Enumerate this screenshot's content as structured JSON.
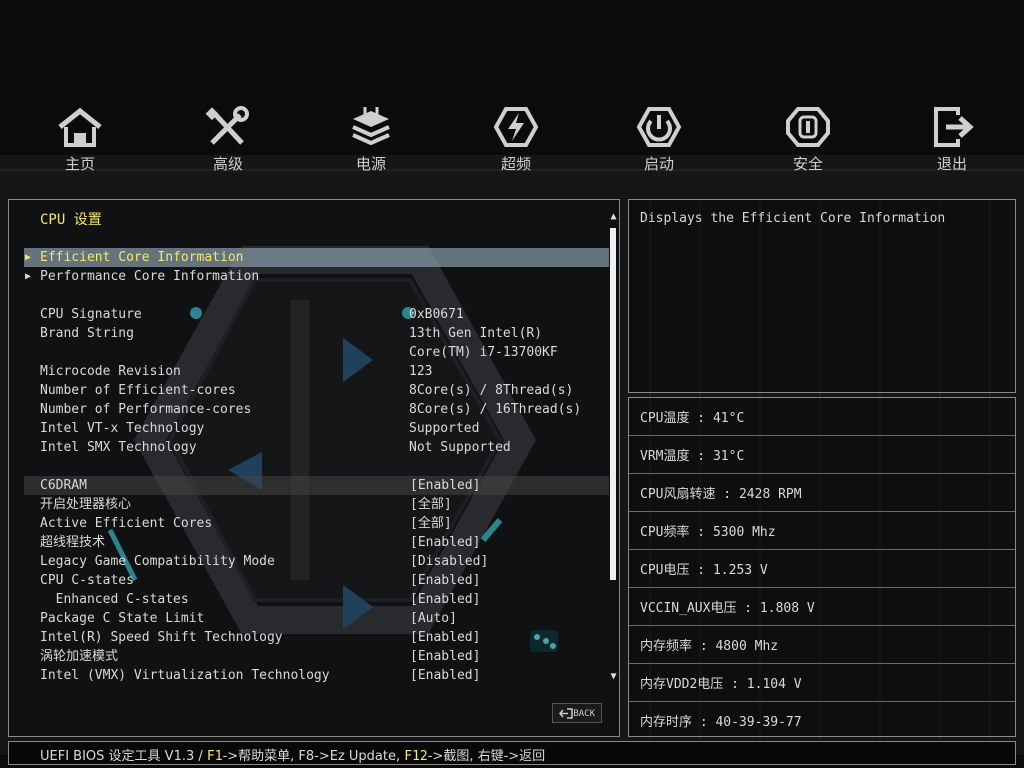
{
  "nav": [
    {
      "label": "主页",
      "icon": "home-icon"
    },
    {
      "label": "高级",
      "icon": "tools-icon"
    },
    {
      "label": "电源",
      "icon": "power-supply-icon"
    },
    {
      "label": "超频",
      "icon": "overclock-icon"
    },
    {
      "label": "启动",
      "icon": "boot-icon"
    },
    {
      "label": "安全",
      "icon": "security-icon"
    },
    {
      "label": "退出",
      "icon": "exit-icon"
    }
  ],
  "section_title": "CPU 设置",
  "submenus": [
    {
      "label": "Efficient Core Information",
      "highlighted": true
    },
    {
      "label": "Performance Core Information",
      "highlighted": false
    }
  ],
  "info": [
    {
      "label": "CPU Signature",
      "value": "0xB0671"
    },
    {
      "label": "Brand String",
      "value": "13th Gen Intel(R)"
    },
    {
      "label": "",
      "value": "Core(TM) i7-13700KF"
    },
    {
      "label": "Microcode Revision",
      "value": "123"
    },
    {
      "label": "Number of Efficient-cores",
      "value": "8Core(s) / 8Thread(s)"
    },
    {
      "label": "Number of Performance-cores",
      "value": "8Core(s) / 16Thread(s)"
    },
    {
      "label": "Intel VT-x Technology",
      "value": "Supported"
    },
    {
      "label": "Intel SMX Technology",
      "value": "Not Supported"
    }
  ],
  "options": [
    {
      "label": "C6DRAM",
      "value": "[Enabled]"
    },
    {
      "label": "开启处理器核心",
      "value": "[全部]"
    },
    {
      "label": "Active Efficient Cores",
      "value": "[全部]"
    },
    {
      "label": "超线程技术",
      "value": "[Enabled]"
    },
    {
      "label": "Legacy Game Compatibility Mode",
      "value": "[Disabled]"
    },
    {
      "label": "CPU C-states",
      "value": "[Enabled]"
    },
    {
      "label": "  Enhanced C-states",
      "value": "[Enabled]"
    },
    {
      "label": "Package C State Limit",
      "value": "[Auto]"
    },
    {
      "label": "Intel(R) Speed Shift Technology",
      "value": "[Enabled]"
    },
    {
      "label": "涡轮加速模式",
      "value": "[Enabled]"
    },
    {
      "label": "Intel (VMX) Virtualization Technology",
      "value": "[Enabled]"
    }
  ],
  "back_label": "BACK",
  "help_text": "Displays the Efficient Core Information",
  "status": [
    "CPU温度 : 41°C",
    "VRM温度 : 31°C",
    "CPU风扇转速 : 2428 RPM",
    "CPU频率 : 5300 Mhz",
    "CPU电压 : 1.253 V",
    "VCCIN_AUX电压 : 1.808 V",
    "内存频率 : 4800 Mhz",
    "内存VDD2电压 : 1.104 V",
    "内存时序 : 40-39-39-77"
  ],
  "footer": {
    "prefix": "UEFI BIOS 设定工具 V1.3 / ",
    "f1_key": "F1",
    "f1_text": "->帮助菜单, F8->Ez Update, ",
    "f12_key": "F12",
    "f12_text": "->截图, 右键->返回"
  },
  "colors": {
    "accent_yellow": "#f2e86a",
    "highlight": "#8296a0",
    "cyan_accent": "#3fc7d4"
  }
}
